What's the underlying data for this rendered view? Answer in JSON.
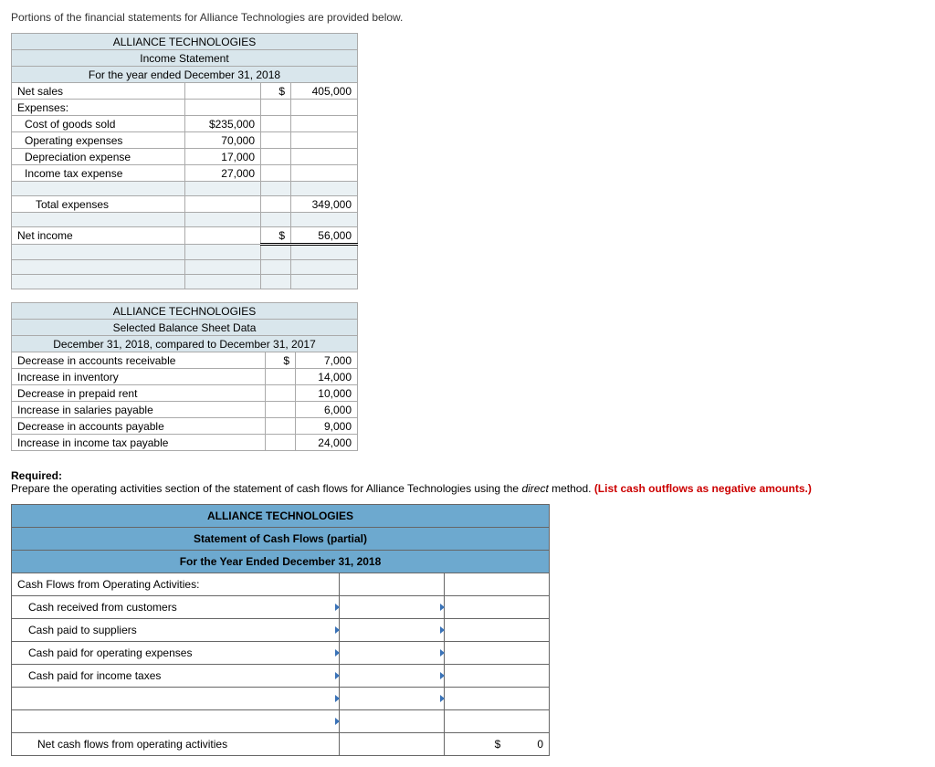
{
  "intro": "Portions of the financial statements for Alliance Technologies are provided below.",
  "income_statement": {
    "company": "ALLIANCE TECHNOLOGIES",
    "title": "Income Statement",
    "period": "For the year ended December 31, 2018",
    "net_sales_label": "Net sales",
    "net_sales_sym": "$",
    "net_sales_val": "405,000",
    "expenses_label": "Expenses:",
    "lines": [
      {
        "label": "Cost of goods sold",
        "val": "$235,000"
      },
      {
        "label": "Operating expenses",
        "val": "70,000"
      },
      {
        "label": "Depreciation expense",
        "val": "17,000"
      },
      {
        "label": "Income tax expense",
        "val": "27,000"
      }
    ],
    "total_expenses_label": "Total expenses",
    "total_expenses_val": "349,000",
    "net_income_label": "Net income",
    "net_income_sym": "$",
    "net_income_val": "56,000"
  },
  "balance_changes": {
    "company": "ALLIANCE TECHNOLOGIES",
    "title": "Selected Balance Sheet Data",
    "period": "December 31, 2018, compared to December 31, 2017",
    "lines": [
      {
        "label": "Decrease in accounts receivable",
        "sym": "$",
        "val": "7,000"
      },
      {
        "label": "Increase in inventory",
        "sym": "",
        "val": "14,000"
      },
      {
        "label": "Decrease in prepaid rent",
        "sym": "",
        "val": "10,000"
      },
      {
        "label": "Increase in salaries payable",
        "sym": "",
        "val": "6,000"
      },
      {
        "label": "Decrease in accounts payable",
        "sym": "",
        "val": "9,000"
      },
      {
        "label": "Increase in income tax payable",
        "sym": "",
        "val": "24,000"
      }
    ]
  },
  "required": {
    "heading": "Required:",
    "text_before": "Prepare the operating activities section of the statement of cash flows for Alliance Technologies using the ",
    "italic": "direct",
    "text_after": " method. ",
    "red": "(List cash outflows as negative amounts.)"
  },
  "answer": {
    "company": "ALLIANCE TECHNOLOGIES",
    "title": "Statement of Cash Flows (partial)",
    "period": "For the Year Ended December 31, 2018",
    "section_label": "Cash Flows from Operating Activities:",
    "rows": [
      "Cash received from customers",
      "Cash paid to suppliers",
      "Cash paid for operating expenses",
      "Cash paid for income taxes"
    ],
    "net_label": "Net cash flows from operating activities",
    "net_sym": "$",
    "net_val": "0"
  }
}
